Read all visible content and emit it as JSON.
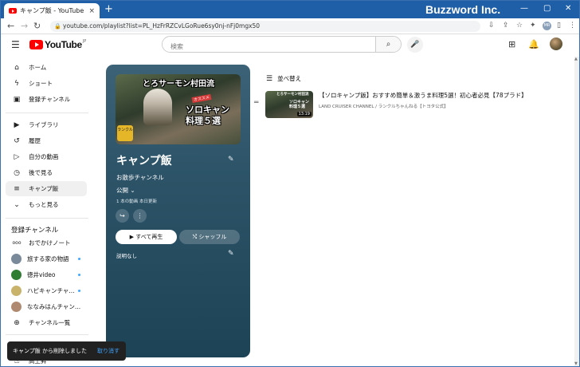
{
  "browser": {
    "tab_title": "キャンプ飯 - YouTube",
    "tab_close": "×",
    "new_tab": "+",
    "url": "youtube.com/playlist?list=PL_HzFrRZCvLGoRue6sy0nj-nFj0mgx50",
    "watermark": "Buzzword Inc.",
    "win_min": "—",
    "win_max": "▢",
    "win_close": "✕",
    "profile_initials": "MR"
  },
  "header": {
    "logo_text": "YouTube",
    "logo_sup": "JP",
    "search_placeholder": "検索"
  },
  "sidebar": {
    "main": [
      {
        "label": "ホーム",
        "icon": "home-icon",
        "glyph": "⌂"
      },
      {
        "label": "ショート",
        "icon": "shorts-icon",
        "glyph": "ϟ"
      },
      {
        "label": "登録チャンネル",
        "icon": "subscriptions-icon",
        "glyph": "▣"
      }
    ],
    "library": [
      {
        "label": "ライブラリ",
        "icon": "library-icon",
        "glyph": "▶"
      },
      {
        "label": "履歴",
        "icon": "history-icon",
        "glyph": "↺"
      },
      {
        "label": "自分の動画",
        "icon": "your-videos-icon",
        "glyph": "▷"
      },
      {
        "label": "後で見る",
        "icon": "watch-later-icon",
        "glyph": "◷"
      },
      {
        "label": "キャンプ飯",
        "icon": "playlist-icon",
        "glyph": "≡"
      },
      {
        "label": "もっと見る",
        "icon": "chevron-down-icon",
        "glyph": "⌄"
      }
    ],
    "subs_heading": "登録チャンネル",
    "subs": [
      {
        "label": "おでかけノート",
        "color": "#555555",
        "glyph": "ooo",
        "dot": false
      },
      {
        "label": "旅する家の物語",
        "color": "#7a8a9a",
        "glyph": "",
        "dot": true
      },
      {
        "label": "徳井video",
        "color": "#2e7d32",
        "glyph": "",
        "dot": true
      },
      {
        "label": "ハピキャンチャ...",
        "color": "#c9b36a",
        "glyph": "",
        "dot": true
      },
      {
        "label": "ななみはんチャン...",
        "color": "#b08a70",
        "glyph": "",
        "dot": false
      },
      {
        "label": "チャンネル一覧",
        "color": "",
        "glyph": "⊕",
        "dot": false
      }
    ],
    "bottom_item": "高上昇"
  },
  "playlist": {
    "thumb_line1": "とろサーモン村田流",
    "thumb_badge": "オススメ",
    "thumb_line2": "ソロキャン",
    "thumb_line3": "料理５選",
    "thumb_brand": "ランクル",
    "title": "キャンプ飯",
    "owner": "お散歩チャンネル",
    "privacy": "公開",
    "meta": "1 本の動画  本日更新",
    "play_all": "すべて再生",
    "shuffle": "シャッフル",
    "description": "説明なし"
  },
  "list": {
    "sort_label": "並べ替え",
    "videos": [
      {
        "title": "【ソロキャンプ飯】おすすめ簡単＆激うま料理5選！初心者必見【78プラド】",
        "channel": "LAND CRUISER CHANNEL / ランクルちゃんねる【トヨタ公式】",
        "duration": "13:19",
        "thumb_line1": "とろサーモン村田流",
        "thumb_line2": "ソロキャン 料理５選"
      }
    ]
  },
  "toast": {
    "message": "キャンプ飯 から削除しました",
    "undo": "取り消す"
  },
  "colors": {
    "brand_red": "#ff0000",
    "card_bg": "#2d5468",
    "link_blue": "#3ea6ff"
  }
}
